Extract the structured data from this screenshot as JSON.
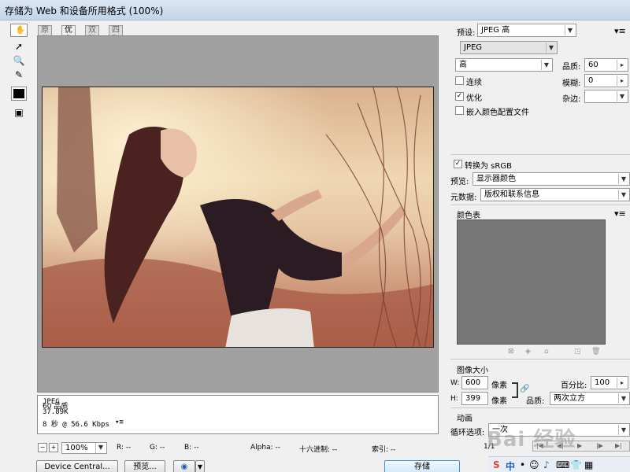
{
  "window": {
    "title": "存储为 Web 和设备所用格式 (100%)"
  },
  "tabs": [
    {
      "label": "原稿"
    },
    {
      "label": "优化"
    },
    {
      "label": "双联"
    },
    {
      "label": "四联"
    }
  ],
  "info": {
    "format": "JPEG",
    "size": "37.89K",
    "time": "8 秒 @ 56.6 Kbps",
    "quality_label": "60 品质"
  },
  "status": {
    "zoom": "100%",
    "r": "R: --",
    "g": "G: --",
    "b": "B: --",
    "alpha": "Alpha: --",
    "hex": "十六进制: --",
    "index": "索引: --"
  },
  "bottom_buttons": {
    "device_central": "Device Central...",
    "preview": "预览...",
    "save": "存储"
  },
  "settings": {
    "preset_label": "预设:",
    "preset_value": "JPEG 高",
    "format_value": "JPEG",
    "quality_preset": "高",
    "quality_label": "品质:",
    "quality_value": "60",
    "progressive": "连续",
    "optimized": "优化",
    "embed_profile": "嵌入颜色配置文件",
    "blur_label": "模糊:",
    "blur_value": "0",
    "matte_label": "杂边:",
    "convert_srgb": "转换为 sRGB",
    "preview_label": "预览:",
    "preview_value": "显示器颜色",
    "metadata_label": "元数据:",
    "metadata_value": "版权和联系信息"
  },
  "color_table": {
    "title": "颜色表"
  },
  "image_size": {
    "title": "图像大小",
    "w_label": "W:",
    "w_value": "600",
    "h_label": "H:",
    "h_value": "399",
    "unit": "像素",
    "percent_label": "百分比:",
    "percent_value": "100",
    "quality_label": "品质:",
    "quality_value": "两次立方"
  },
  "animation": {
    "title": "动画",
    "loop_label": "循环选项:",
    "loop_value": "一次",
    "frame": "1/1"
  },
  "watermark": "Bai 经验",
  "colors": {
    "accent": "#3b8ed3",
    "canvas_bg": "#a0a0a0",
    "color_table_bg": "#777777"
  }
}
